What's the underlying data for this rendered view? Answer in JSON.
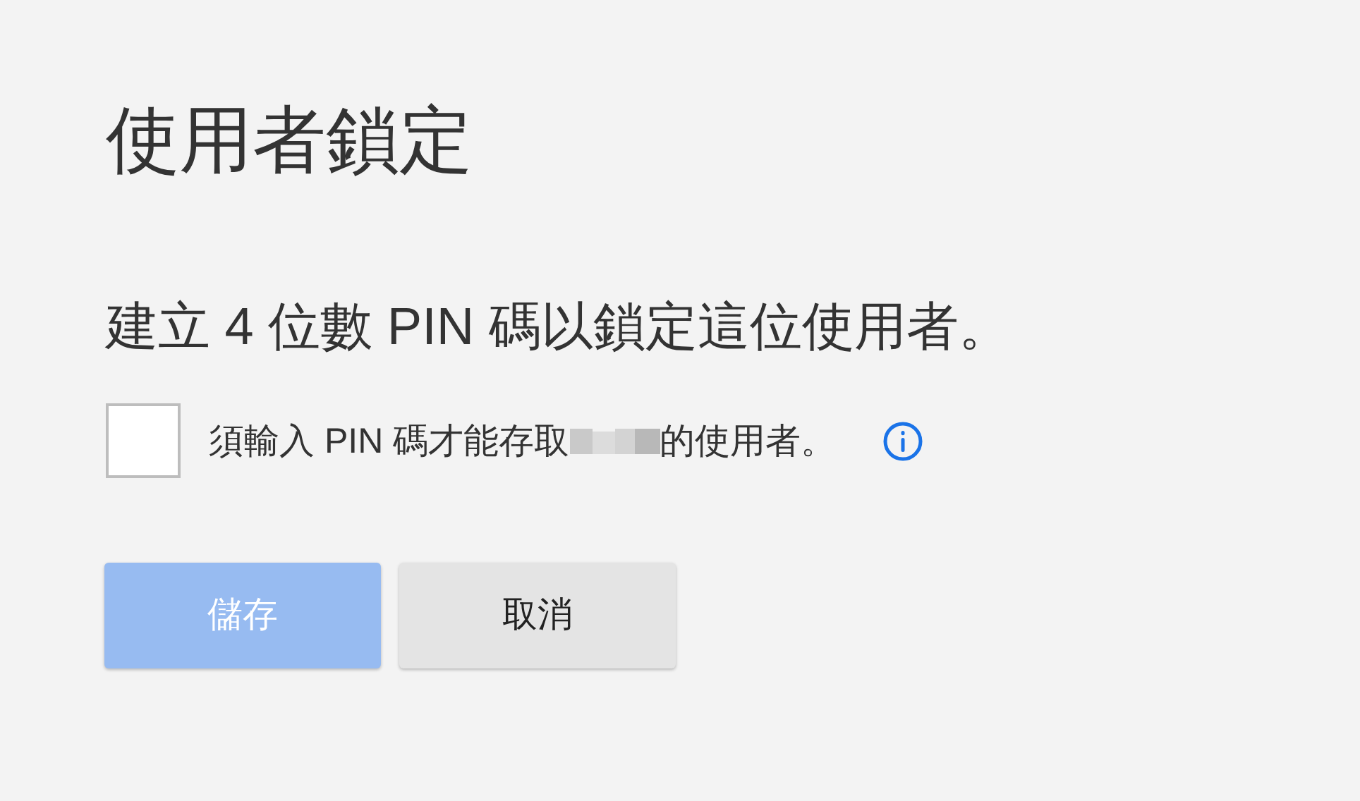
{
  "title": "使用者鎖定",
  "instruction": "建立 4 位數 PIN 碼以鎖定這位使用者。",
  "option": {
    "checked": false,
    "label_before": "須輸入 PIN 碼才能存取",
    "label_after": "的使用者。"
  },
  "buttons": [
    {
      "label": "儲存",
      "kind": "primary",
      "disabled": true
    },
    {
      "label": "取消",
      "kind": "secondary",
      "disabled": false
    }
  ]
}
